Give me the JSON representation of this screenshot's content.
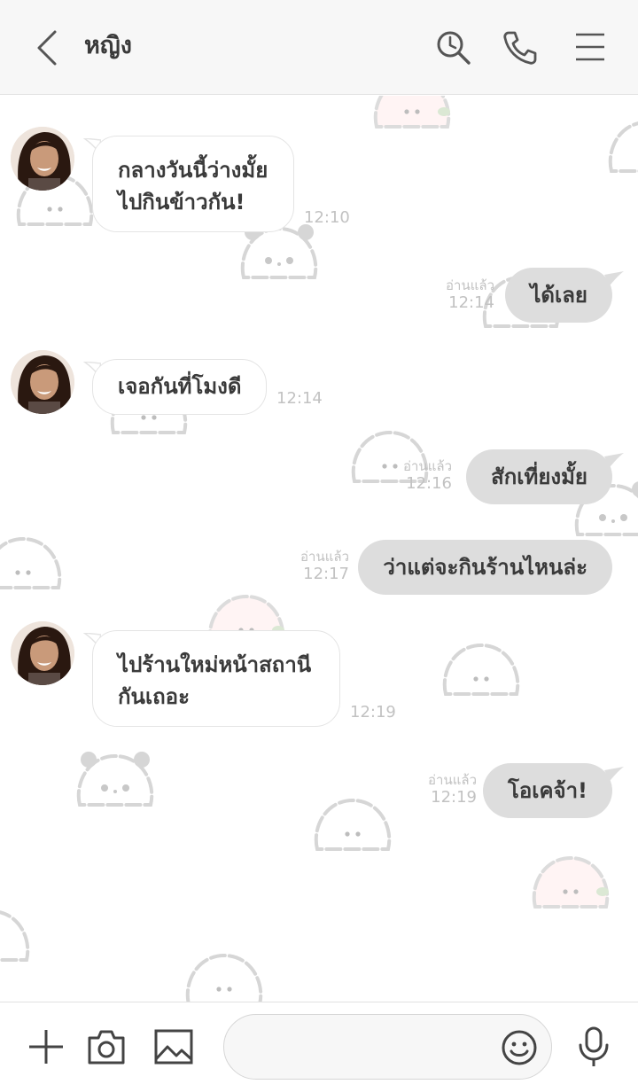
{
  "header": {
    "title": "หญิง",
    "icons": [
      "back-icon",
      "search-icon",
      "phone-icon",
      "menu-icon"
    ]
  },
  "messages": [
    {
      "direction": "incoming",
      "lines": [
        "กลางวันนี้ว่างมั้ย",
        "ไปกินข้าวกัน!"
      ],
      "time": "12:10"
    },
    {
      "direction": "outgoing",
      "text": "ได้เลย",
      "read": "อ่านแล้ว",
      "time": "12:14"
    },
    {
      "direction": "incoming",
      "lines": [
        "เจอกันที่โมงดี"
      ],
      "time": "12:14"
    },
    {
      "direction": "outgoing",
      "text": "สักเที่ยงมั้ย",
      "read": "อ่านแล้ว",
      "time": "12:16"
    },
    {
      "direction": "outgoing",
      "text": "ว่าแต่จะกินร้านไหนล่ะ",
      "read": "อ่านแล้ว",
      "time": "12:17"
    },
    {
      "direction": "incoming",
      "lines": [
        "ไปร้านใหม่หน้าสถานี",
        "กันเถอะ"
      ],
      "time": "12:19"
    },
    {
      "direction": "outgoing",
      "text": "โอเคจ้า!",
      "read": "อ่านแล้ว",
      "time": "12:19"
    }
  ],
  "footer": {
    "input_value": "",
    "icons": [
      "plus-icon",
      "camera-icon",
      "image-icon",
      "emoji-icon",
      "microphone-icon"
    ]
  },
  "colors": {
    "header_bg": "#f7f7f7",
    "chat_bg": "#ffffff",
    "outgoing_bubble": "#dddddd",
    "incoming_bubble": "#ffffff",
    "meta_text": "#c2c2c2"
  }
}
